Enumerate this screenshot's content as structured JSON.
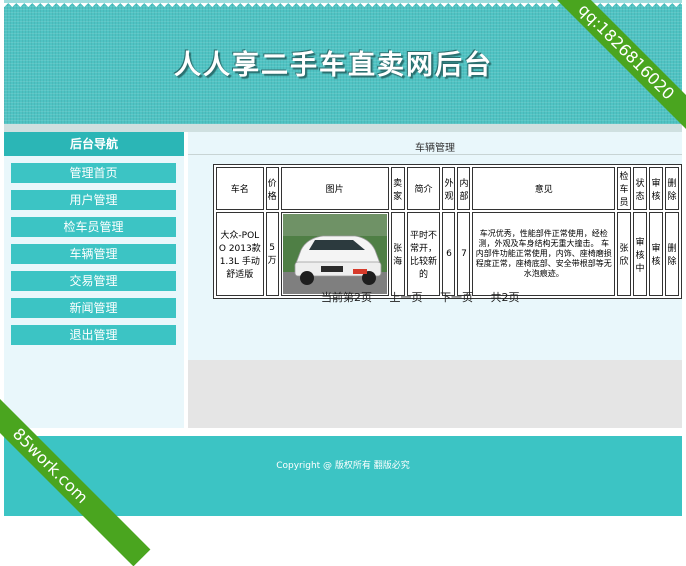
{
  "header": {
    "title": "人人享二手车直卖网后台"
  },
  "sidebar": {
    "title": "后台导航",
    "items": [
      {
        "label": "管理首页"
      },
      {
        "label": "用户管理"
      },
      {
        "label": "检车员管理"
      },
      {
        "label": "车辆管理"
      },
      {
        "label": "交易管理"
      },
      {
        "label": "新闻管理"
      },
      {
        "label": "退出管理"
      }
    ]
  },
  "main": {
    "title": "车辆管理",
    "table": {
      "headers": [
        "车名",
        "价格",
        "图片",
        "卖家",
        "简介",
        "外观",
        "内部",
        "意见",
        "检车员",
        "状态",
        "审核",
        "删除"
      ],
      "rows": [
        {
          "name": "大众-POLO 2013款 1.3L 手动舒适版",
          "price": "5万",
          "seller": "张海",
          "intro": "平时不常开，比较新的",
          "exterior": "6",
          "interior": "7",
          "opinion": "车况优秀，性能部件正常使用，经检测，外观及车身结构无重大撞击。 车内部件功能正常使用，内饰、座椅磨损程度正常，座椅底部、安全带根部等无水泡痕迹。",
          "inspector": "张欣",
          "status": "审核中",
          "review": "审核",
          "delete": "删除"
        }
      ]
    },
    "pager": {
      "current": "当前第2页",
      "prev": "上一页",
      "next": "下一页",
      "total": "共2页"
    }
  },
  "footer": {
    "copyright": "Copyright @ 版权所有 翻版必究"
  },
  "watermarks": {
    "top_right": "qq:1826816020",
    "bottom_left": "85work.com"
  },
  "colors": {
    "primary": "#3cc4c4",
    "panel": "#e9f7fb",
    "ribbon": "#4aa51f"
  }
}
